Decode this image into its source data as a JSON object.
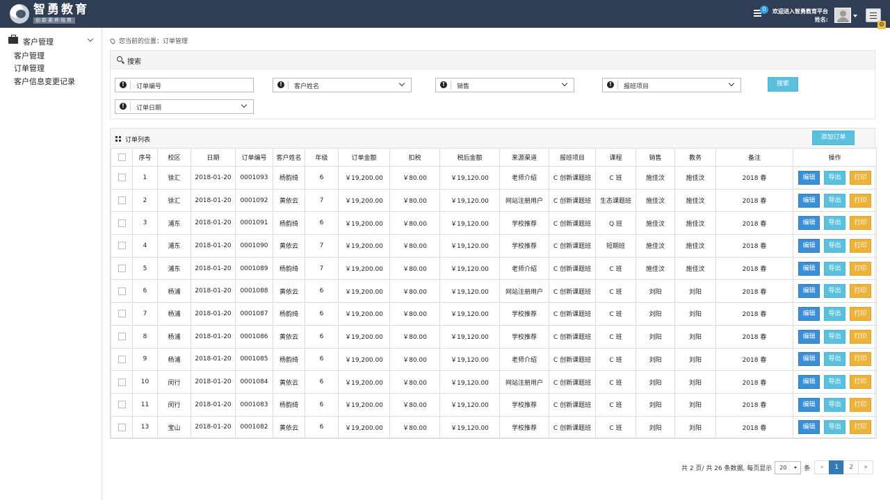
{
  "brand": {
    "title": "智勇教育",
    "slogan": "创新素养培育"
  },
  "topbar": {
    "notif_count": "0",
    "welcome": "欢迎进入智勇教育平台",
    "username_label": "姓名:"
  },
  "sidebar": {
    "group": "客户管理",
    "items": [
      "客户管理",
      "订单管理",
      "客户信息变更记录"
    ]
  },
  "breadcrumb": "您当前的位置：订单管理",
  "search": {
    "title": "搜索",
    "fields": {
      "order_no": "订单编号",
      "customer": "客户姓名",
      "sales": "销售",
      "course": "报班项目",
      "date": "订单日期"
    },
    "button": "搜索"
  },
  "list": {
    "title": "订单列表",
    "add_button": "添加订单",
    "columns": [
      "序号",
      "校区",
      "日期",
      "订单编号",
      "客户姓名",
      "年级",
      "订单金额",
      "扣税",
      "税后金额",
      "来源渠道",
      "报班项目",
      "课程",
      "销售",
      "教务",
      "备注",
      "操作"
    ],
    "action_labels": {
      "edit": "编辑",
      "export": "导出",
      "print": "打印"
    },
    "rows": [
      [
        "1",
        "徐汇",
        "2018-01-20",
        "0001093",
        "杨韵绮",
        "6",
        "￥19,200.00",
        "￥80.00",
        "￥19,120.00",
        "老师介绍",
        "C 创新课题班",
        "C 班",
        "施佳汶",
        "施佳汶",
        "2018 春"
      ],
      [
        "2",
        "徐汇",
        "2018-01-20",
        "0001092",
        "黄依云",
        "7",
        "￥19,200.00",
        "￥80.00",
        "￥19,120.00",
        "网站注册用户",
        "C 创新课题班",
        "生态课题班",
        "施佳汶",
        "施佳汶",
        "2018 春"
      ],
      [
        "3",
        "浦东",
        "2018-01-20",
        "0001091",
        "杨韵绮",
        "6",
        "￥19,200.00",
        "￥80.00",
        "￥19,120.00",
        "学校推荐",
        "C 创新课题班",
        "Q 班",
        "施佳汶",
        "施佳汶",
        "2018 春"
      ],
      [
        "4",
        "浦东",
        "2018-01-20",
        "0001090",
        "黄依云",
        "7",
        "￥19,200.00",
        "￥80.00",
        "￥19,120.00",
        "学校推荐",
        "C 创新课题班",
        "短期班",
        "施佳汶",
        "施佳汶",
        "2018 春"
      ],
      [
        "5",
        "浦东",
        "2018-01-20",
        "0001089",
        "杨韵绮",
        "7",
        "￥19,200.00",
        "￥80.00",
        "￥19,120.00",
        "老师介绍",
        "C 创新课题班",
        "C 班",
        "施佳汶",
        "施佳汶",
        "2018 春"
      ],
      [
        "6",
        "杨浦",
        "2018-01-20",
        "0001088",
        "黄依云",
        "6",
        "￥19,200.00",
        "￥80.00",
        "￥19,120.00",
        "网站注册用户",
        "C 创新课题班",
        "C 班",
        "刘阳",
        "刘阳",
        "2018 春"
      ],
      [
        "7",
        "杨浦",
        "2018-01-20",
        "0001087",
        "杨韵绮",
        "6",
        "￥19,200.00",
        "￥80.00",
        "￥19,120.00",
        "学校推荐",
        "C 创新课题班",
        "C 班",
        "刘阳",
        "刘阳",
        "2018 春"
      ],
      [
        "8",
        "杨浦",
        "2018-01-20",
        "0001086",
        "黄依云",
        "6",
        "￥19,200.00",
        "￥80.00",
        "￥19,120.00",
        "学校推荐",
        "C 创新课题班",
        "C 班",
        "刘阳",
        "刘阳",
        "2018 春"
      ],
      [
        "9",
        "杨浦",
        "2018-01-20",
        "0001085",
        "杨韵绮",
        "6",
        "￥19,200.00",
        "￥80.00",
        "￥19,120.00",
        "老师介绍",
        "C 创新课题班",
        "C 班",
        "刘阳",
        "刘阳",
        "2018 春"
      ],
      [
        "10",
        "闵行",
        "2018-01-20",
        "0001084",
        "黄依云",
        "6",
        "￥19,200.00",
        "￥80.00",
        "￥19,120.00",
        "网站注册用户",
        "C 创新课题班",
        "C 班",
        "刘阳",
        "刘阳",
        "2018 春"
      ],
      [
        "11",
        "闵行",
        "2018-01-20",
        "0001083",
        "杨韵绮",
        "6",
        "￥19,200.00",
        "￥80.00",
        "￥19,120.00",
        "学校推荐",
        "C 创新课题班",
        "C 班",
        "刘阳",
        "刘阳",
        "2018 春"
      ],
      [
        "13",
        "宝山",
        "2018-01-20",
        "0001082",
        "黄依云",
        "6",
        "￥19,200.00",
        "￥80.00",
        "￥19,120.00",
        "学校推荐",
        "C 创新课题班",
        "C 班",
        "刘阳",
        "刘阳",
        "2018 春"
      ]
    ]
  },
  "pagination": {
    "summary": "共 2 页/ 共 26 条数据, 每页显示",
    "page_size": "20",
    "unit": "条",
    "prev": "«",
    "pages": [
      "1",
      "2"
    ],
    "current": "1",
    "next": "»"
  },
  "colors": {
    "topbar": "#2f3e54",
    "primary": "#337ab7",
    "info": "#5bc0de",
    "warning": "#eeb239"
  }
}
